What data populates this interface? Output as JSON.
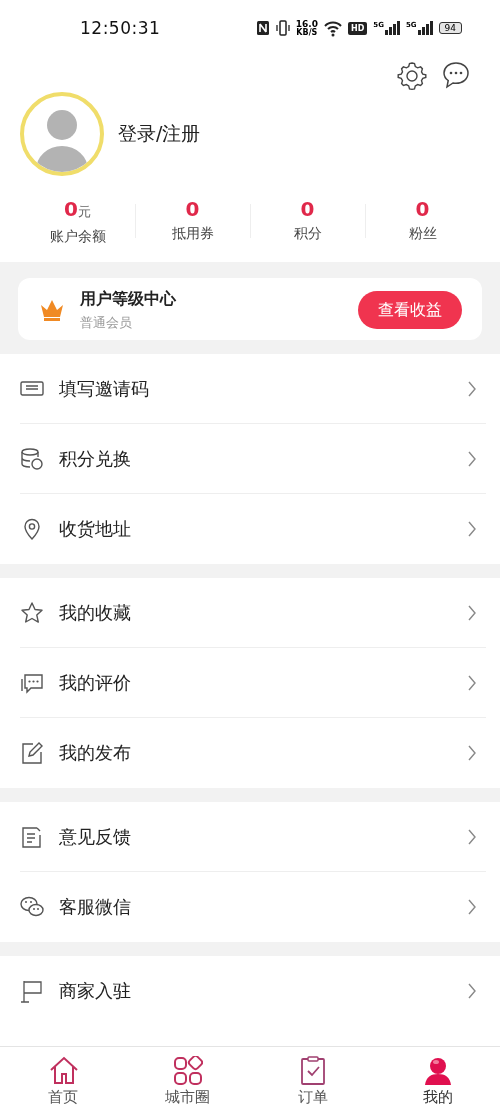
{
  "status_bar": {
    "time": "12:50:31",
    "speed_value": "16.0",
    "speed_unit": "KB/S",
    "hd": "HD",
    "sims": [
      "5G",
      "5G"
    ],
    "battery": "94"
  },
  "profile": {
    "login": "登录/注册"
  },
  "stats": [
    {
      "value": "0",
      "unit": "元",
      "label": "账户余额"
    },
    {
      "value": "0",
      "label": "抵用券"
    },
    {
      "value": "0",
      "label": "积分"
    },
    {
      "value": "0",
      "label": "粉丝"
    }
  ],
  "level_card": {
    "title": "用户等级中心",
    "subtitle": "普通会员",
    "button": "查看收益"
  },
  "menu_groups": [
    {
      "items": [
        {
          "label": "填写邀请码"
        },
        {
          "label": "积分兑换"
        },
        {
          "label": "收货地址"
        }
      ]
    },
    {
      "items": [
        {
          "label": "我的收藏"
        },
        {
          "label": "我的评价"
        },
        {
          "label": "我的发布"
        }
      ]
    },
    {
      "items": [
        {
          "label": "意见反馈"
        },
        {
          "label": "客服微信"
        }
      ]
    },
    {
      "items": [
        {
          "label": "商家入驻"
        }
      ]
    }
  ],
  "tab_bar": [
    {
      "label": "首页",
      "selected": false
    },
    {
      "label": "城市圈",
      "selected": false
    },
    {
      "label": "订单",
      "selected": false
    },
    {
      "label": "我的",
      "selected": true
    }
  ]
}
